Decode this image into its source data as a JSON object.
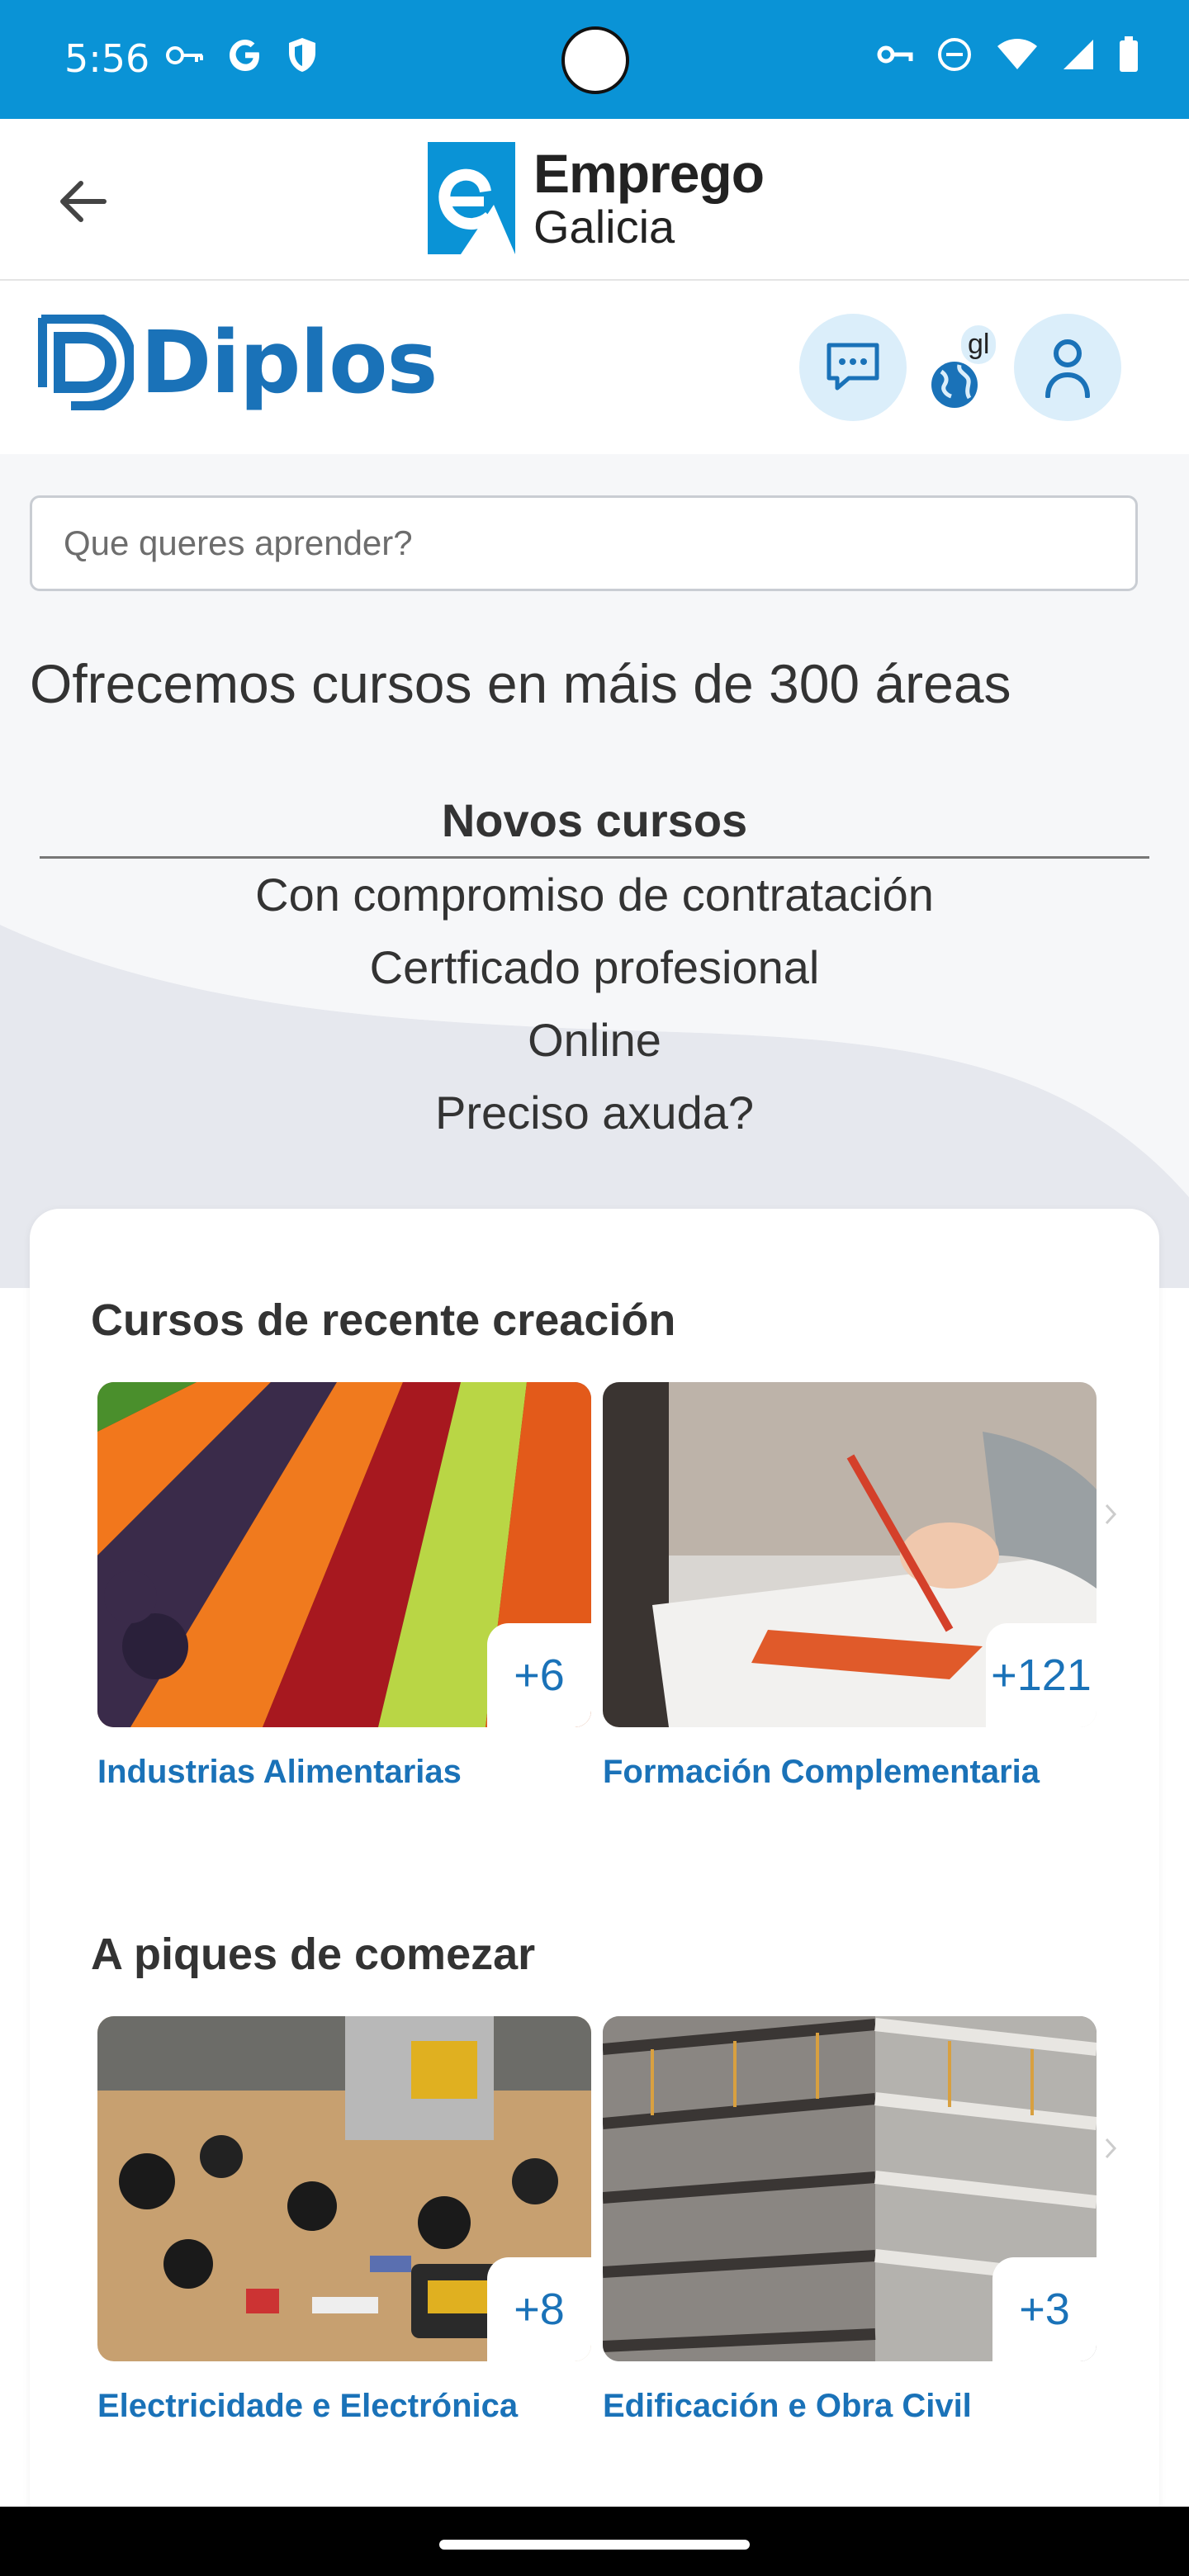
{
  "status_bar": {
    "time": "5:56",
    "left_icons": [
      "key-icon",
      "google-icon",
      "shield-icon"
    ],
    "right_icons": [
      "vpn-key-icon",
      "do-not-disturb-icon",
      "wifi-icon",
      "signal-icon",
      "battery-icon"
    ]
  },
  "app_header": {
    "brand_title": "Emprego",
    "brand_subtitle": "Galicia"
  },
  "diplos": {
    "logo_text": "Diplos",
    "language_code": "gl"
  },
  "search": {
    "placeholder": "Que queres aprender?"
  },
  "hero": {
    "headline": "Ofrecemos cursos en máis de 300 áreas",
    "menu": [
      {
        "label": "Novos cursos",
        "active": true
      },
      {
        "label": "Con compromiso de contratación",
        "active": false
      },
      {
        "label": "Certficado profesional",
        "active": false
      },
      {
        "label": "Online",
        "active": false
      },
      {
        "label": "Preciso axuda?",
        "active": false
      }
    ]
  },
  "sections": [
    {
      "title": "Cursos de recente creación",
      "tiles": [
        {
          "label": "Industrias Alimentarias",
          "count": "+6"
        },
        {
          "label": "Formación Complementaria",
          "count": "+121"
        }
      ]
    },
    {
      "title": "A piques de comezar",
      "tiles": [
        {
          "label": "Electricidade e Electrónica",
          "count": "+8"
        },
        {
          "label": "Edificación e Obra Civil",
          "count": "+3"
        }
      ]
    }
  ],
  "colors": {
    "status_bar": "#0a93d6",
    "brand_blue": "#1a72b8",
    "hero_bg": "#f5f6f8"
  }
}
